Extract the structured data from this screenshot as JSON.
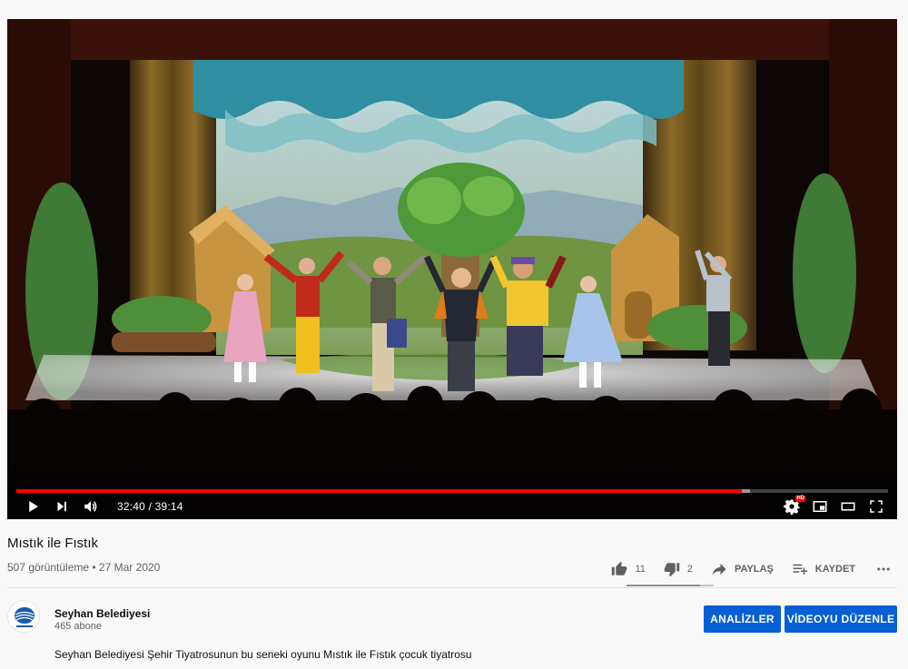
{
  "player": {
    "time_current": "32:40",
    "time_total": "39:14",
    "progress_played": 0.832,
    "progress_buffered": 0.827,
    "hd_label": "HD"
  },
  "video": {
    "title": "Mıstık ile Fıstık",
    "views_date": "507 görüntüleme • 27 Mar 2020"
  },
  "actions": {
    "likes": "11",
    "dislikes": "2",
    "share_label": "PAYLAŞ",
    "save_label": "KAYDET",
    "like_ratio": 0.846
  },
  "channel": {
    "name": "Seyhan Belediyesi",
    "subscribers": "465 abone"
  },
  "buttons": {
    "analytics": "ANALİZLER",
    "edit": "VİDEOYU DÜZENLE"
  },
  "description": "Seyhan Belediyesi Şehir Tiyatrosunun bu seneki oyunu Mıstık ile Fıstık çocuk tiyatrosu",
  "colors": {
    "accent_blue": "#065fd4",
    "progress_red": "#ff0000"
  }
}
